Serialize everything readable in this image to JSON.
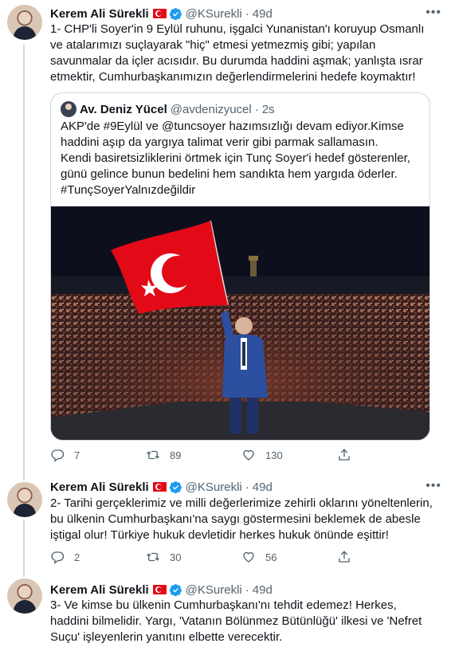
{
  "tweets": [
    {
      "author": "Kerem Ali Sürekli",
      "handle": "@KSurekli",
      "separator": "·",
      "time": "49d",
      "text": "1- CHP'li Soyer'in 9 Eylül ruhunu, işgalci Yunanistan'ı koruyup Osmanlı ve atalarımızı suçlayarak \"hiç\" etmesi yetmezmiş gibi; yapılan savunmalar da içler acısıdır. Bu durumda haddini aşmak; yanlışta ısrar etmektir, Cumhurbaşkanımızın değerlendirmelerini hedefe koymaktır!",
      "replies": "7",
      "retweets": "89",
      "likes": "130"
    },
    {
      "author": "Kerem Ali Sürekli",
      "handle": "@KSurekli",
      "separator": "·",
      "time": "49d",
      "text": "2- Tarihi gerçeklerimiz ve milli değerlerimize zehirli oklarını yöneltenlerin, bu ülkenin Cumhurbaşkanı'na saygı göstermesini beklemek de abesle iştigal olur! Türkiye hukuk devletidir herkes hukuk önünde eşittir!",
      "replies": "2",
      "retweets": "30",
      "likes": "56"
    },
    {
      "author": "Kerem Ali Sürekli",
      "handle": "@KSurekli",
      "separator": "·",
      "time": "49d",
      "text": "3- Ve kimse bu ülkenin Cumhurbaşkanı'nı tehdit edemez! Herkes, haddini bilmelidir. Yargı, 'Vatanın Bölünmez Bütünlüğü' ilkesi ve 'Nefret Suçu' işleyenlerin yanıtını elbette verecektir."
    }
  ],
  "quote": {
    "author": "Av. Deniz Yücel",
    "handle": "@avdenizyucel",
    "separator": "·",
    "time": "2s",
    "line1": "AKP'de #9Eylül ve @tuncsoyer hazımsızlığı devam ediyor.Kimse haddini aşıp da yargıya talimat verir gibi parmak sallamasın.",
    "line2": "Kendi basiretsizliklerini örtmek için Tunç Soyer'i hedef gösterenler, günü gelince bunun bedelini hem sandıkta hem yargıda öderler.",
    "line3": "#TunçSoyerYalnızdeğildir"
  },
  "icons": {
    "reply": "reply-icon",
    "retweet": "retweet-icon",
    "like": "heart-icon",
    "share": "share-icon",
    "verified": "verified-badge-icon",
    "flag": "turkish-flag-icon",
    "more": "more-options-icon"
  },
  "colors": {
    "verified": "#1d9bf0",
    "flag": "#e30a17",
    "muted": "#536471",
    "border": "#cfd9de"
  }
}
